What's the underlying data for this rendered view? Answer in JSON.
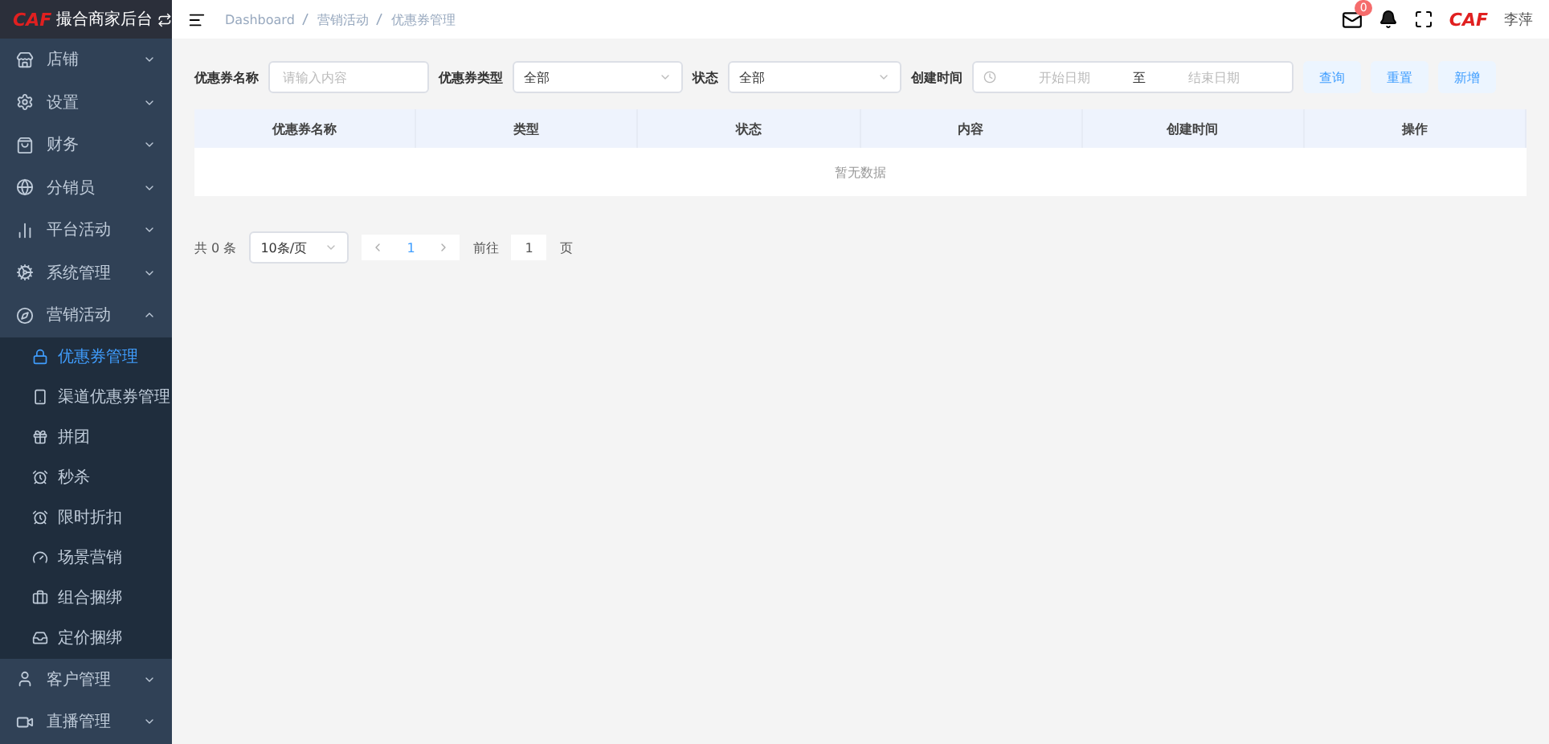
{
  "sidebar": {
    "logo": "CAF",
    "title": "撮合商家后台",
    "items": [
      {
        "label": "店铺",
        "expanded": false
      },
      {
        "label": "设置",
        "expanded": false
      },
      {
        "label": "财务",
        "expanded": false
      },
      {
        "label": "分销员",
        "expanded": false
      },
      {
        "label": "平台活动",
        "expanded": false
      },
      {
        "label": "系统管理",
        "expanded": false
      },
      {
        "label": "营销活动",
        "expanded": true,
        "children": [
          {
            "label": "优惠券管理",
            "selected": true
          },
          {
            "label": "渠道优惠券管理",
            "selected": false
          },
          {
            "label": "拼团",
            "selected": false
          },
          {
            "label": "秒杀",
            "selected": false
          },
          {
            "label": "限时折扣",
            "selected": false
          },
          {
            "label": "场景营销",
            "selected": false
          },
          {
            "label": "组合捆绑",
            "selected": false
          },
          {
            "label": "定价捆绑",
            "selected": false
          }
        ]
      },
      {
        "label": "客户管理",
        "expanded": false
      },
      {
        "label": "直播管理",
        "expanded": false
      }
    ]
  },
  "header": {
    "breadcrumbs": [
      "Dashboard",
      "营销活动",
      "优惠券管理"
    ],
    "mail_count": "0",
    "avatar_logo": "CAF",
    "user": "李萍"
  },
  "filters": [
    {
      "kind": "input",
      "label": "优惠券名称",
      "placeholder": "请输入内容"
    },
    {
      "kind": "select",
      "label": "优惠券类型",
      "value": "全部"
    },
    {
      "kind": "select",
      "label": "状态",
      "value": "全部"
    },
    {
      "kind": "daterange",
      "label": "创建时间",
      "start_placeholder": "开始日期",
      "separator": "至",
      "end_placeholder": "结束日期"
    }
  ],
  "buttons": [
    "查询",
    "重置",
    "新增"
  ],
  "table": {
    "columns": [
      "优惠券名称",
      "类型",
      "状态",
      "内容",
      "创建时间",
      "操作"
    ],
    "empty_text": "暂无数据"
  },
  "pagination": {
    "total": "共 0 条",
    "page_size": "10条/页",
    "pages": [
      {
        "label": "1",
        "selected": true
      }
    ],
    "goto_label": "前往",
    "goto_value": "1",
    "goto_suffix": "页"
  }
}
